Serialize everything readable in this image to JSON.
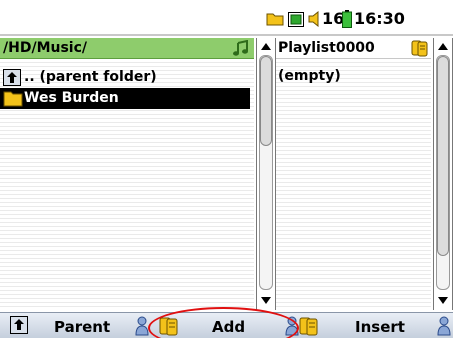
{
  "status_bar": {
    "volume_level": "16",
    "clock": "16:30",
    "icons": [
      "folder-icon",
      "screen-icon",
      "volume-icon",
      "battery-icon"
    ]
  },
  "left_pane": {
    "path": "/HD/Music/",
    "header_icon": "music-note-icon",
    "items": [
      {
        "label": ".. (parent folder)",
        "icon": "parent-folder-icon",
        "selected": false
      },
      {
        "label": "Wes Burden",
        "icon": "folder-icon",
        "selected": true
      }
    ]
  },
  "right_pane": {
    "title": "Playlist0000",
    "header_icon": "playlist-icon",
    "empty_text": "(empty)"
  },
  "bottom_bar": {
    "parent_label": "Parent",
    "add_label": "Add",
    "insert_label": "Insert"
  },
  "colors": {
    "header_green": "#8ecc6c",
    "selection": "#000000",
    "annotation": "#e01010",
    "folder_yellow": "#f3c21a"
  }
}
